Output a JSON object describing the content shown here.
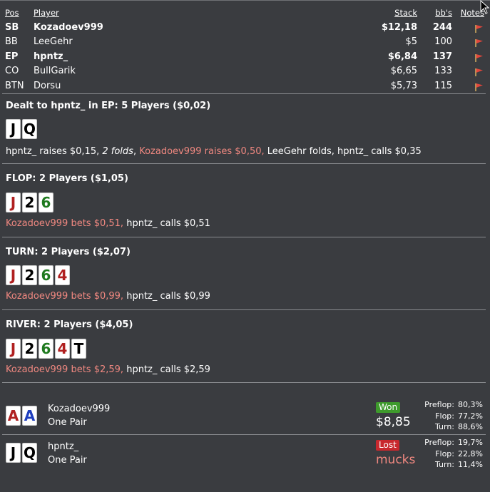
{
  "colors": {
    "background": "#3a3c40",
    "highlight": "#f08880",
    "red_card": "#b02020",
    "green_card": "#1f7a1f",
    "blue_card": "#1f3fbf",
    "won": "#3e9a2c",
    "lost": "#c8282e"
  },
  "players_table": {
    "headers": {
      "pos": "Pos",
      "player": "Player",
      "stack": "Stack",
      "bbs": "bb's",
      "notes": "Notes"
    },
    "rows": [
      {
        "pos": "SB",
        "player": "Kozadoev999",
        "stack": "$12,18",
        "bbs": "244",
        "bold": true,
        "note_icon": "flag-icon"
      },
      {
        "pos": "BB",
        "player": "LeeGehr",
        "stack": "$5",
        "bbs": "100",
        "bold": false,
        "note_icon": "flag-icon"
      },
      {
        "pos": "EP",
        "player": "hpntz_",
        "stack": "$6,84",
        "bbs": "137",
        "bold": true,
        "note_icon": "flag-icon"
      },
      {
        "pos": "CO",
        "player": "BullGarik",
        "stack": "$6,65",
        "bbs": "133",
        "bold": false,
        "note_icon": "flag-icon"
      },
      {
        "pos": "BTN",
        "player": "Dorsu",
        "stack": "$5,73",
        "bbs": "115",
        "bold": false,
        "note_icon": "flag-icon"
      }
    ]
  },
  "preflop": {
    "title": "Dealt to hpntz_ in EP: 5 Players ($0,02)",
    "cards": [
      {
        "rank": "J",
        "suit": "spades"
      },
      {
        "rank": "Q",
        "suit": "spades"
      }
    ],
    "actions": [
      {
        "text": "hpntz_ raises $0,15, ",
        "style": "normal"
      },
      {
        "text": "2 folds",
        "style": "italic"
      },
      {
        "text": ", ",
        "style": "normal"
      },
      {
        "text": "Kozadoev999 raises $0,50,",
        "style": "highlight"
      },
      {
        "text": " LeeGehr folds, hpntz_ calls $0,35",
        "style": "normal"
      }
    ]
  },
  "flop": {
    "title": "FLOP: 2 Players ($1,05)",
    "cards": [
      {
        "rank": "J",
        "suit": "hearts"
      },
      {
        "rank": "2",
        "suit": "spades"
      },
      {
        "rank": "6",
        "suit": "clubs"
      }
    ],
    "actions": [
      {
        "text": "Kozadoev999 bets $0,51,",
        "style": "highlight"
      },
      {
        "text": " hpntz_ calls $0,51",
        "style": "normal"
      }
    ]
  },
  "turn": {
    "title": "TURN: 2 Players ($2,07)",
    "cards": [
      {
        "rank": "J",
        "suit": "hearts"
      },
      {
        "rank": "2",
        "suit": "spades"
      },
      {
        "rank": "6",
        "suit": "clubs"
      },
      {
        "rank": "4",
        "suit": "hearts"
      }
    ],
    "actions": [
      {
        "text": "Kozadoev999 bets $0,99,",
        "style": "highlight"
      },
      {
        "text": " hpntz_ calls $0,99",
        "style": "normal"
      }
    ]
  },
  "river": {
    "title": "RIVER: 2 Players ($4,05)",
    "cards": [
      {
        "rank": "J",
        "suit": "hearts"
      },
      {
        "rank": "2",
        "suit": "spades"
      },
      {
        "rank": "6",
        "suit": "clubs"
      },
      {
        "rank": "4",
        "suit": "hearts"
      },
      {
        "rank": "T",
        "suit": "spades"
      }
    ],
    "actions": [
      {
        "text": "Kozadoev999 bets $2,59,",
        "style": "highlight"
      },
      {
        "text": " hpntz_ calls $2,59",
        "style": "normal"
      }
    ]
  },
  "showdown": [
    {
      "player": "Kozadoev999",
      "hand": "One Pair",
      "cards": [
        {
          "rank": "A",
          "suit": "hearts"
        },
        {
          "rank": "A",
          "suit": "diamonds"
        }
      ],
      "result": "Won",
      "amount": "$8,85",
      "equity": [
        {
          "label": "Preflop:",
          "value": "80,3%"
        },
        {
          "label": "Flop:",
          "value": "77,2%"
        },
        {
          "label": "Turn:",
          "value": "88,6%"
        }
      ]
    },
    {
      "player": "hpntz_",
      "hand": "One Pair",
      "cards": [
        {
          "rank": "J",
          "suit": "spades"
        },
        {
          "rank": "Q",
          "suit": "spades"
        }
      ],
      "result": "Lost",
      "amount": "mucks",
      "equity": [
        {
          "label": "Preflop:",
          "value": "19,7%"
        },
        {
          "label": "Flop:",
          "value": "22,8%"
        },
        {
          "label": "Turn:",
          "value": "11,4%"
        }
      ]
    }
  ]
}
